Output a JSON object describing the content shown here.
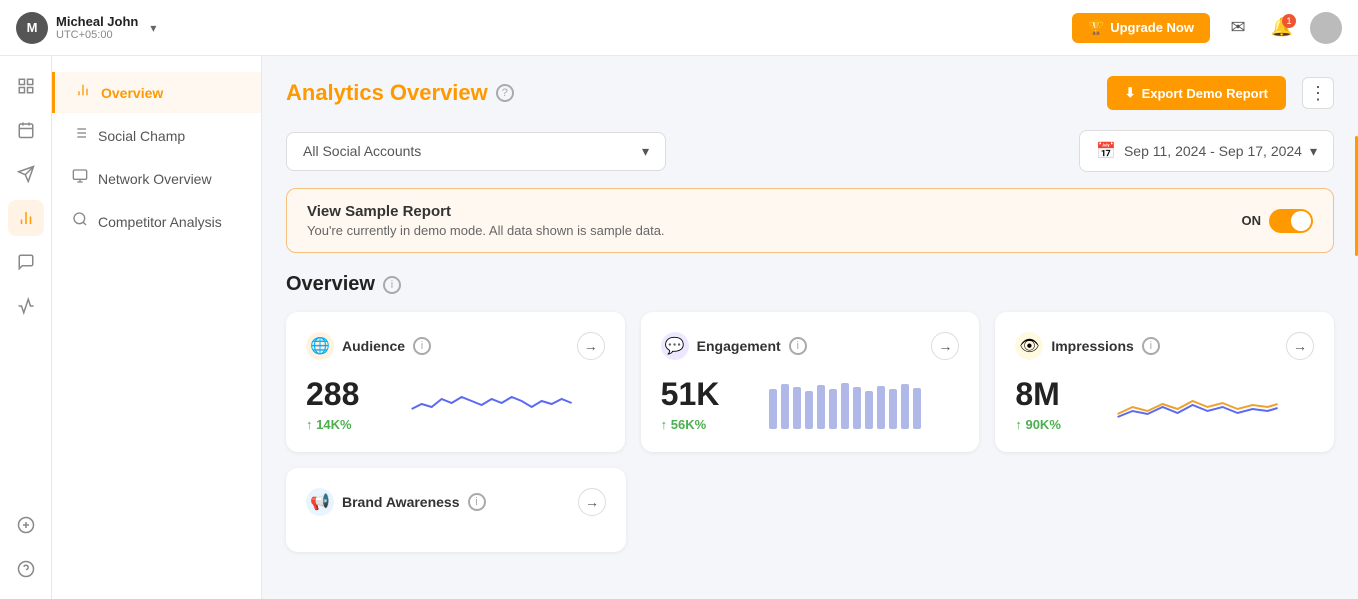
{
  "topbar": {
    "user": {
      "name": "Micheal John",
      "timezone": "UTC+05:00",
      "initials": "M"
    },
    "upgrade_btn": "Upgrade Now",
    "notification_count": "1"
  },
  "nav": {
    "items": [
      {
        "id": "overview",
        "label": "Overview",
        "active": true
      },
      {
        "id": "social-champ",
        "label": "Social Champ",
        "active": false
      },
      {
        "id": "network-overview",
        "label": "Network Overview",
        "active": false
      },
      {
        "id": "competitor-analysis",
        "label": "Competitor Analysis",
        "active": false
      }
    ]
  },
  "page": {
    "title": "Analytics Overview",
    "help_icon": "?",
    "export_btn": "Export Demo Report"
  },
  "filters": {
    "accounts_placeholder": "All Social Accounts",
    "date_range": "Sep 11, 2024 - Sep 17, 2024"
  },
  "demo_banner": {
    "title": "View Sample Report",
    "description": "You're currently in demo mode. All data shown is sample data.",
    "toggle_label": "ON"
  },
  "overview": {
    "title": "Overview",
    "cards": [
      {
        "id": "audience",
        "title": "Audience",
        "value": "288",
        "change": "14K%",
        "icon_char": "🌐"
      },
      {
        "id": "engagement",
        "title": "Engagement",
        "value": "51K",
        "change": "56K%",
        "icon_char": "💬"
      },
      {
        "id": "impressions",
        "title": "Impressions",
        "value": "8M",
        "change": "90K%",
        "icon_char": "👁"
      }
    ],
    "brand_card": {
      "title": "Brand Awareness"
    }
  },
  "icons": {
    "chart": "📊",
    "calendar": "📅",
    "send": "✈",
    "bars": "📶",
    "chat": "💬",
    "plus": "＋",
    "question": "?"
  }
}
